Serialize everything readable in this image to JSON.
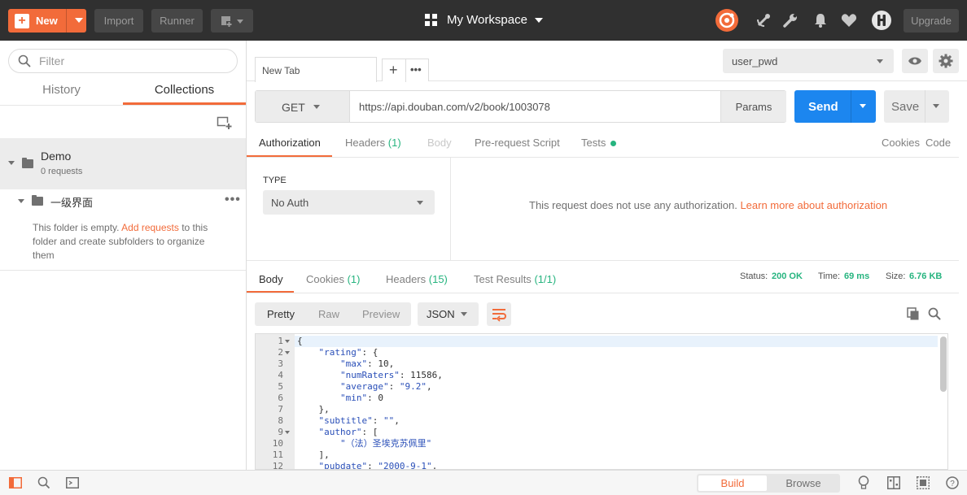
{
  "topbar": {
    "new_label": "New",
    "import_label": "Import",
    "runner_label": "Runner",
    "workspace_label": "My Workspace",
    "upgrade_label": "Upgrade"
  },
  "sidebar": {
    "filter_placeholder": "Filter",
    "tab_history": "History",
    "tab_collections": "Collections",
    "collection_name": "Demo",
    "collection_meta": "0 requests",
    "folder_name": "一级界面",
    "empty_text_1": "This folder is empty. ",
    "empty_link": "Add requests",
    "empty_text_2": " to this folder and create subfolders to organize them"
  },
  "tabs": {
    "active_label": "New Tab"
  },
  "environment": {
    "selected": "user_pwd"
  },
  "request": {
    "method": "GET",
    "url": "https://api.douban.com/v2/book/1003078",
    "params_label": "Params",
    "send_label": "Send",
    "save_label": "Save"
  },
  "request_tabs": {
    "authorization": "Authorization",
    "headers": "Headers",
    "headers_count": "(1)",
    "body": "Body",
    "prerequest": "Pre-request Script",
    "tests": "Tests",
    "cookies": "Cookies",
    "code": "Code"
  },
  "auth": {
    "type_label": "TYPE",
    "type_value": "No Auth",
    "message": "This request does not use any authorization. ",
    "learn_link": "Learn more about authorization"
  },
  "response_tabs": {
    "body": "Body",
    "cookies": "Cookies",
    "cookies_count": "(1)",
    "headers": "Headers",
    "headers_count": "(15)",
    "test_results": "Test Results",
    "test_count": "(1/1)",
    "status_label": "Status:",
    "status_value": "200 OK",
    "time_label": "Time:",
    "time_value": "69 ms",
    "size_label": "Size:",
    "size_value": "6.76 KB"
  },
  "response_toolbar": {
    "pretty": "Pretty",
    "raw": "Raw",
    "preview": "Preview",
    "format": "JSON"
  },
  "code_lines": [
    {
      "n": "1",
      "fold": true,
      "text": "{"
    },
    {
      "n": "2",
      "fold": true,
      "text": "    \"rating\": {"
    },
    {
      "n": "3",
      "fold": false,
      "text": "        \"max\": 10,"
    },
    {
      "n": "4",
      "fold": false,
      "text": "        \"numRaters\": 11586,"
    },
    {
      "n": "5",
      "fold": false,
      "text": "        \"average\": \"9.2\","
    },
    {
      "n": "6",
      "fold": false,
      "text": "        \"min\": 0"
    },
    {
      "n": "7",
      "fold": false,
      "text": "    },"
    },
    {
      "n": "8",
      "fold": false,
      "text": "    \"subtitle\": \"\","
    },
    {
      "n": "9",
      "fold": true,
      "text": "    \"author\": ["
    },
    {
      "n": "10",
      "fold": false,
      "text": "        \"（法）圣埃克苏佩里\""
    },
    {
      "n": "11",
      "fold": false,
      "text": "    ],"
    },
    {
      "n": "12",
      "fold": false,
      "text": "    \"pubdate\": \"2000-9-1\","
    }
  ],
  "bottombar": {
    "build_label": "Build",
    "browse_label": "Browse"
  },
  "colors": {
    "accent": "#f26b3a",
    "primary_button": "#1c86ef",
    "success": "#26b47f",
    "topbar": "#303030"
  }
}
